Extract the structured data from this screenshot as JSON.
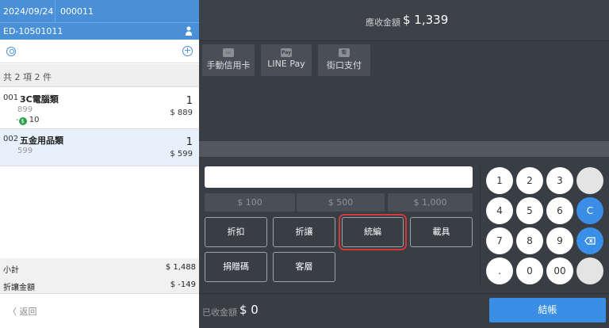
{
  "header": {
    "date": "2024/09/24",
    "seq": "000011",
    "code": "ED-10501011"
  },
  "summary": {
    "count_text": "共 2 項 2 件"
  },
  "items": [
    {
      "no": "001",
      "name": "3C電腦類",
      "price": "899",
      "qty": "1",
      "amount": "$ 889",
      "discount": "10"
    },
    {
      "no": "002",
      "name": "五金用品類",
      "price": "599",
      "qty": "1",
      "amount": "$ 599"
    }
  ],
  "totals": {
    "subtotal_label": "小計",
    "subtotal": "$ 1,488",
    "discount_label": "折讓金額",
    "discount": "$ -149"
  },
  "back_label": "〈 返回",
  "due": {
    "label": "應收金額",
    "amount": "$ 1,339"
  },
  "payments": [
    {
      "label": "手動信用卡",
      "icon": "credit-card-icon"
    },
    {
      "label": "LINE Pay",
      "icon": "line-pay-icon"
    },
    {
      "label": "街口支付",
      "icon": "jkopay-icon"
    }
  ],
  "quick_amounts": [
    "$ 100",
    "$ 500",
    "$ 1,000"
  ],
  "functions": [
    "折扣",
    "折讓",
    "統編",
    "載具",
    "捐贈碼",
    "客層"
  ],
  "keypad": [
    "1",
    "2",
    "3",
    "4",
    "5",
    "6",
    "C",
    "7",
    "8",
    "9",
    "0",
    "00",
    "."
  ],
  "paid": {
    "label": "已收金額",
    "amount": "$ 0"
  },
  "checkout_label": "結帳",
  "colors": {
    "primary": "#4a90d9",
    "accent": "#3a8ee6",
    "highlight": "#d0393c",
    "discount_green": "#2e9e4a"
  }
}
